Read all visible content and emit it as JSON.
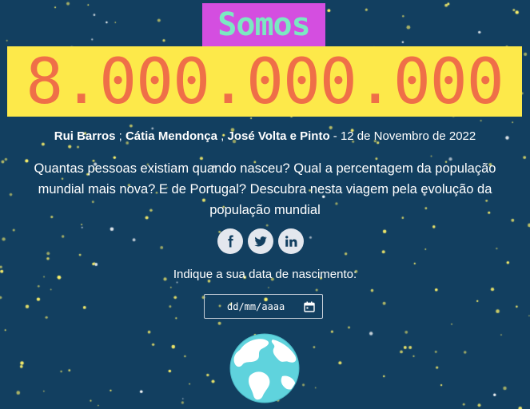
{
  "header": {
    "somos": "Somos",
    "population": "8.000.000.000"
  },
  "byline": {
    "author1": "Rui Barros",
    "sep1": " ; ",
    "author2": "Cátia Mendonça",
    "sep2": " , ",
    "author3": "José Volta e Pinto",
    "date": " - 12 de Novembro de 2022"
  },
  "intro": "Quantas pessoas existiam quando nasceu? Qual a percentagem da população mundial mais nova? E de Portugal? Descubra nesta viagem pela evolução da população mundial",
  "social": {
    "facebook_icon": "facebook-icon",
    "twitter_icon": "twitter-icon",
    "linkedin_icon": "linkedin-icon"
  },
  "birthdate": {
    "prompt": "Indique a sua data de nascimento:",
    "placeholder": "dd/mm/aaaa"
  },
  "colors": {
    "background": "#123f60",
    "somos_bg": "#d44ee0",
    "somos_text": "#7ce8c2",
    "number_bg": "#fde94a",
    "number_text": "#ef6f48",
    "stars": "#fff36a"
  }
}
